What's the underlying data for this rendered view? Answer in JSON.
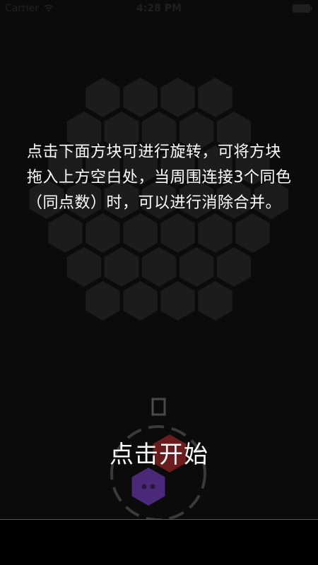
{
  "status_bar": {
    "carrier": "Carrier",
    "time": "4:28 PM",
    "wifi_icon": "wifi-icon",
    "battery_icon": "battery-icon"
  },
  "board": {
    "cell_color": "#1c1c1c",
    "rows": [
      4,
      5,
      6,
      7,
      6,
      5,
      4
    ]
  },
  "instructions": {
    "text": "点击下面方块可进行旋转，可将方块拖入上方空白处，当周围连接3个同色（同点数）时，可以进行消除合并。"
  },
  "piece": {
    "tile_colors": [
      "#6b1c1c",
      "#4a2a78"
    ],
    "dot_color": "#2a1440",
    "rotate_ring_color": "#3a3a3a",
    "small_square_icon": "square-outline-icon"
  },
  "start_button": {
    "label": "点击开始"
  },
  "colors": {
    "background": "#0b0b0b",
    "bottom_bar": "#000000",
    "divider": "#5a5a5a"
  }
}
